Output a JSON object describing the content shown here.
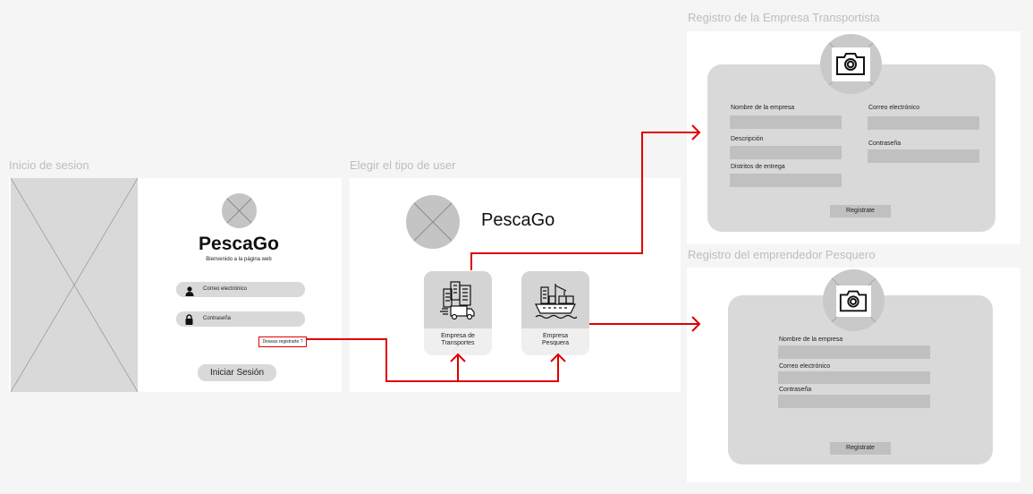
{
  "frames": {
    "login": {
      "title": "Inicio de sesion"
    },
    "choose": {
      "title": "Elegir el tipo de user"
    },
    "company": {
      "title": "Registro de la Empresa Transportista"
    },
    "fisher": {
      "title": "Registro del emprendedor Pesquero"
    }
  },
  "login": {
    "brand": "PescaGo",
    "welcome": "Bienvenido a la página web",
    "email_placeholder": "Correo electrónico",
    "password_placeholder": "Contraseña",
    "register_link": "Deseas registrarte ?",
    "login_button": "Iniciar Sesión"
  },
  "choose": {
    "brand": "PescaGo",
    "cards": [
      {
        "label_line1": "Empresa de",
        "label_line2": "Transportes",
        "icon": "truck-building-icon"
      },
      {
        "label_line1": "Empresa",
        "label_line2": "Pesquera",
        "icon": "ship-icon"
      }
    ]
  },
  "company_form": {
    "fields": [
      "Nombre de la empresa",
      "Descripción",
      "Distritos de entrega",
      "Correo electrónico",
      "Contraseña"
    ],
    "submit": "Registrate",
    "icon": "camera-icon"
  },
  "fisher_form": {
    "fields": [
      "Nombre de la empresa",
      "Correo electrónico",
      "Contraseña"
    ],
    "submit": "Registrate",
    "icon": "camera-icon"
  },
  "colors": {
    "arrow": "#e00000",
    "background": "#f5f5f5",
    "placeholder": "#d9d9d9"
  }
}
